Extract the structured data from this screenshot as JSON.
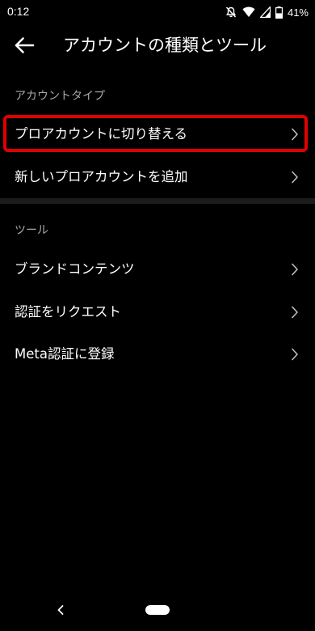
{
  "status_bar": {
    "time": "0:12",
    "battery_percent": "41%",
    "icons": [
      "mute-notifications-icon",
      "wifi-icon",
      "signal-icon",
      "battery-icon"
    ]
  },
  "header": {
    "title": "アカウントの種類とツール",
    "back_icon": "arrow-left-icon"
  },
  "sections": [
    {
      "title": "アカウントタイプ",
      "items": [
        {
          "label": "プロアカウントに切り替える",
          "highlighted": true
        },
        {
          "label": "新しいプロアカウントを追加"
        }
      ]
    },
    {
      "title": "ツール",
      "items": [
        {
          "label": "ブランドコンテンツ"
        },
        {
          "label": "認証をリクエスト"
        },
        {
          "label": "Meta認証に登録"
        }
      ]
    }
  ],
  "colors": {
    "background": "#000000",
    "text": "#ffffff",
    "secondary_text": "#a8a8a8",
    "highlight": "#e00000",
    "divider": "#1c1c1c"
  },
  "nav_bar": {
    "icons": [
      "nav-back-icon",
      "home-pill-icon"
    ]
  }
}
